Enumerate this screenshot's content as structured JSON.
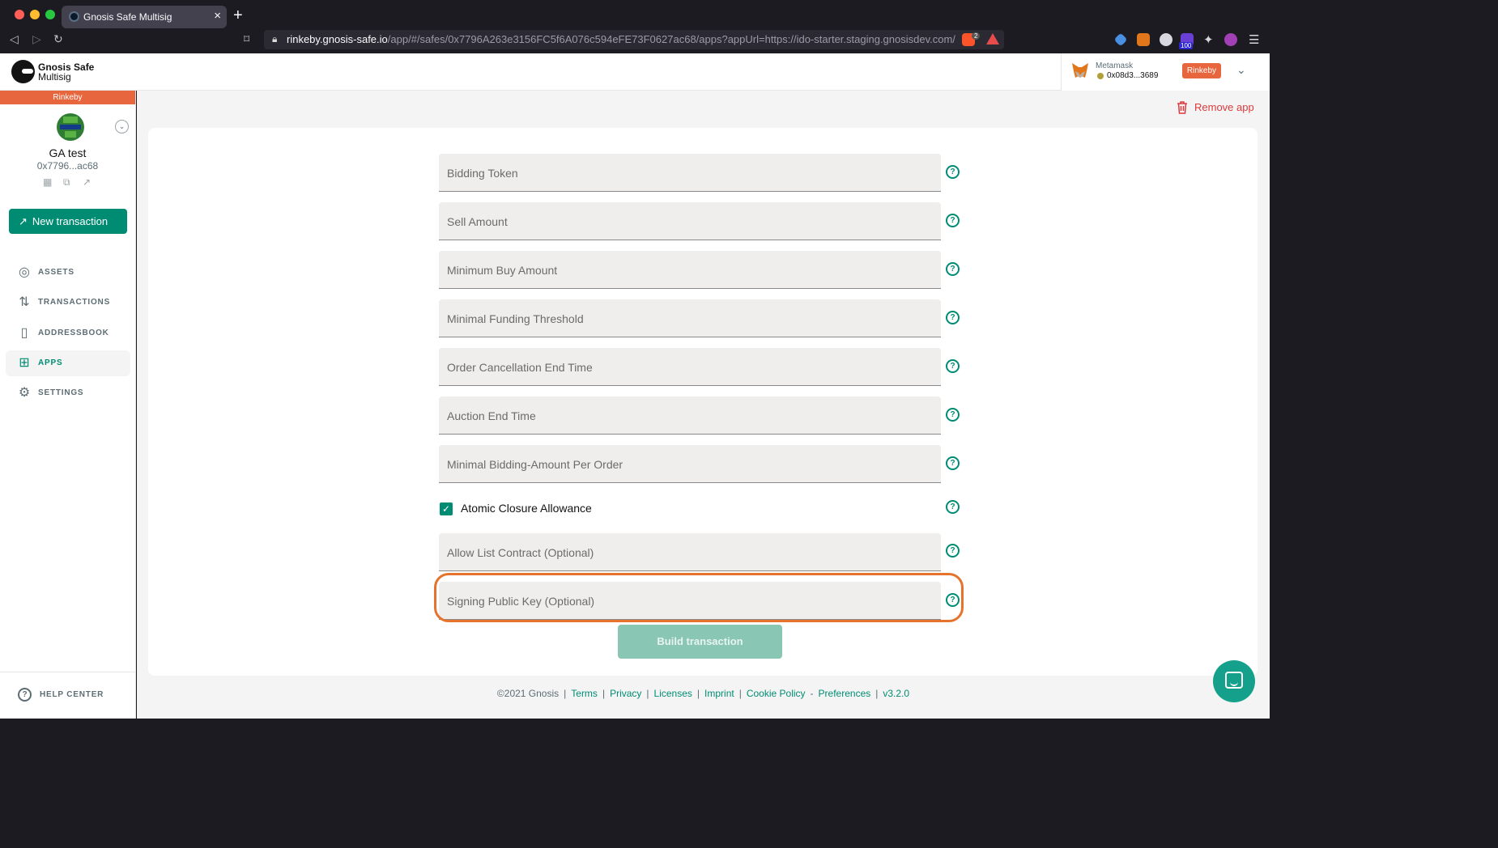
{
  "browser": {
    "tab_title": "Gnosis Safe Multisig",
    "url_host": "rinkeby.gnosis-safe.io",
    "url_path": "/app/#/safes/0x7796A263e3156FC5f6A076c594eFE73F0627ac68/apps?appUrl=https://ido-starter.staging.gnosisdev.com/",
    "extension_badges": [
      "2",
      "100"
    ]
  },
  "header": {
    "logo_title": "Gnosis Safe",
    "logo_subtitle": "Multisig",
    "wallet_name": "Metamask",
    "wallet_address": "0x08d3...3689",
    "network_badge": "Rinkeby"
  },
  "sidebar": {
    "network": "Rinkeby",
    "safe_name": "GA test",
    "safe_address": "0x7796...ac68",
    "new_transaction": "New transaction",
    "items": [
      {
        "label": "ASSETS",
        "icon": "assets-icon",
        "active": false
      },
      {
        "label": "TRANSACTIONS",
        "icon": "transactions-icon",
        "active": false
      },
      {
        "label": "ADDRESSBOOK",
        "icon": "addressbook-icon",
        "active": false
      },
      {
        "label": "APPS",
        "icon": "apps-icon",
        "active": true
      },
      {
        "label": "SETTINGS",
        "icon": "settings-icon",
        "active": false
      }
    ],
    "help_center": "HELP CENTER"
  },
  "main": {
    "remove_app": "Remove app",
    "fields": [
      {
        "placeholder": "Bidding Token"
      },
      {
        "placeholder": "Sell Amount"
      },
      {
        "placeholder": "Minimum Buy Amount"
      },
      {
        "placeholder": "Minimal Funding Threshold"
      },
      {
        "placeholder": "Order Cancellation End Time"
      },
      {
        "placeholder": "Auction End Time"
      },
      {
        "placeholder": "Minimal Bidding-Amount Per Order"
      }
    ],
    "checkbox_label": "Atomic Closure Allowance",
    "checkbox_checked": true,
    "optional_fields": [
      {
        "placeholder": "Allow List Contract (Optional)"
      },
      {
        "placeholder": "Signing Public Key (Optional)"
      }
    ],
    "build_button": "Build transaction"
  },
  "footer": {
    "copyright": "©2021 Gnosis",
    "links": [
      "Terms",
      "Privacy",
      "Licenses",
      "Imprint",
      "Cookie Policy",
      "Preferences",
      "v3.2.0"
    ]
  },
  "colors": {
    "accent": "#008c73",
    "network": "#e8663d",
    "danger": "#db3a3d",
    "highlight": "#e5732c"
  }
}
